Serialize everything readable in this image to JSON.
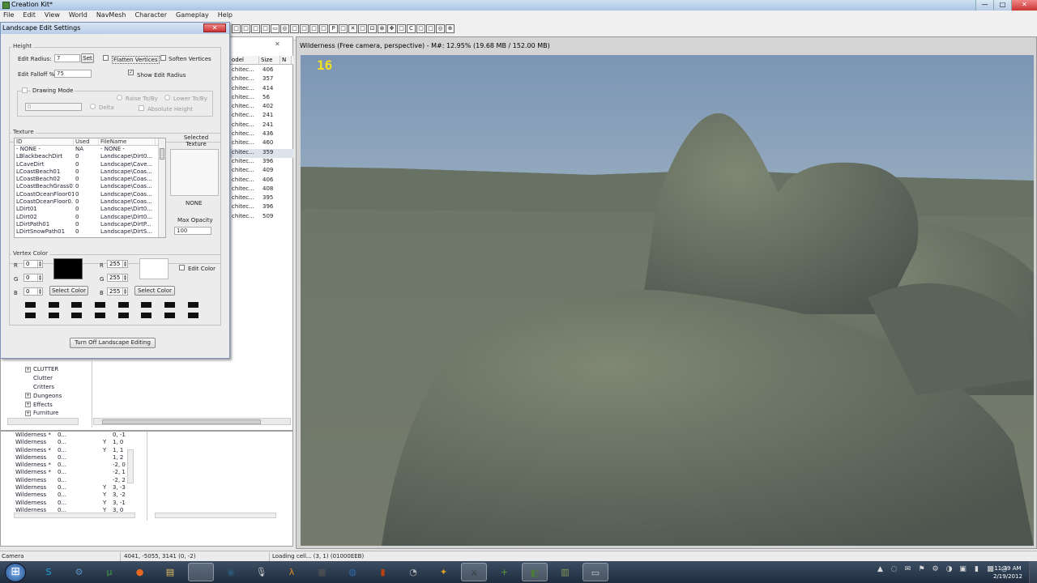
{
  "window": {
    "title": "Creation Kit*",
    "controls": [
      "—",
      "□",
      "✕"
    ]
  },
  "menu": [
    "File",
    "Edit",
    "View",
    "World",
    "NavMesh",
    "Character",
    "Gameplay",
    "Help"
  ],
  "toolbar_icons": [
    "□",
    "□",
    "□",
    "□",
    "▭",
    "◎",
    "□",
    "□",
    "□",
    "□",
    "P",
    "□",
    "✕",
    "□",
    "⊡",
    "⊗",
    "✥",
    "□",
    "C",
    "▢",
    "□",
    "◎",
    "⊕"
  ],
  "object_window": {
    "columns": [
      "odel",
      "Size",
      "N"
    ],
    "rows": [
      {
        "model": "chitec...",
        "size": "406"
      },
      {
        "model": "chitec...",
        "size": "357"
      },
      {
        "model": "chitec...",
        "size": "414"
      },
      {
        "model": "chitec...",
        "size": "56"
      },
      {
        "model": "chitec...",
        "size": "402"
      },
      {
        "model": "chitec...",
        "size": "241"
      },
      {
        "model": "chitec...",
        "size": "241"
      },
      {
        "model": "chitec...",
        "size": "436"
      },
      {
        "model": "chitec...",
        "size": "460"
      },
      {
        "model": "chitec...",
        "size": "359"
      },
      {
        "model": "chitec...",
        "size": "396"
      },
      {
        "model": "chitec...",
        "size": "409"
      },
      {
        "model": "chitec...",
        "size": "406"
      },
      {
        "model": "chitec...",
        "size": "408"
      },
      {
        "model": "chitec...",
        "size": "395"
      },
      {
        "model": "chitec...",
        "size": "396"
      },
      {
        "model": "chitec...",
        "size": "509"
      }
    ],
    "tree": [
      {
        "label": "CLUTTER",
        "expandable": true
      },
      {
        "label": "Clutter",
        "expandable": false
      },
      {
        "label": "Critters",
        "expandable": false
      },
      {
        "label": "Dungeons",
        "expandable": true
      },
      {
        "label": "Effects",
        "expandable": true
      },
      {
        "label": "Furniture",
        "expandable": true
      }
    ]
  },
  "cell_view": {
    "rows": [
      {
        "name": "Wilderness *",
        "editor": "0...",
        "loaded": "",
        "coords": "0, -1"
      },
      {
        "name": "Wilderness",
        "editor": "0...",
        "loaded": "Y",
        "coords": "1, 0"
      },
      {
        "name": "Wilderness *",
        "editor": "0...",
        "loaded": "Y",
        "coords": "1, 1"
      },
      {
        "name": "Wilderness",
        "editor": "0...",
        "loaded": "",
        "coords": "1, 2"
      },
      {
        "name": "Wilderness *",
        "editor": "0...",
        "loaded": "",
        "coords": "-2, 0"
      },
      {
        "name": "Wilderness *",
        "editor": "0...",
        "loaded": "",
        "coords": "-2, 1"
      },
      {
        "name": "Wilderness",
        "editor": "0...",
        "loaded": "",
        "coords": "-2, 2"
      },
      {
        "name": "Wilderness",
        "editor": "0...",
        "loaded": "Y",
        "coords": "3, -3"
      },
      {
        "name": "Wilderness",
        "editor": "0...",
        "loaded": "Y",
        "coords": "3, -2"
      },
      {
        "name": "Wilderness",
        "editor": "0...",
        "loaded": "Y",
        "coords": "3, -1"
      },
      {
        "name": "Wilderness",
        "editor": "0...",
        "loaded": "Y",
        "coords": "3, 0"
      }
    ]
  },
  "render_window": {
    "title": "Wilderness (Free camera, perspective) - M#: 12.95% (19.68 MB / 152.00 MB)",
    "fps": "16"
  },
  "landscape_dialog": {
    "title": "Landscape Edit Settings",
    "close": "✕",
    "height_group": "Height",
    "edit_radius_label": "Edit Radius:",
    "edit_radius": "7",
    "set_button": "Set",
    "flatten_vertices": "Flatten Vertices",
    "soften_vertices": "Soften Vertices",
    "edit_falloff_label": "Edit Falloff %:",
    "edit_falloff": "75",
    "show_edit_radius": "Show Edit Radius",
    "show_edit_radius_checked": "✓",
    "drawing_mode": "Drawing Mode",
    "drawing_value": "0",
    "delta": "Delta",
    "raise_to_by": "Raise To/By",
    "lower_to_by": "Lower To/By",
    "absolute_height": "Absolute Height",
    "texture_group": "Texture",
    "texture_columns": [
      "ID",
      "Used",
      "FileName"
    ],
    "textures": [
      {
        "id": "- NONE -",
        "used": "NA",
        "file": "- NONE -"
      },
      {
        "id": "LBlackbeachDirt",
        "used": "0",
        "file": "Landscape\\Dirt0..."
      },
      {
        "id": "LCaveDirt",
        "used": "0",
        "file": "Landscape\\Cave..."
      },
      {
        "id": "LCoastBeach01",
        "used": "0",
        "file": "Landscape\\Coas..."
      },
      {
        "id": "LCoastBeach02",
        "used": "0",
        "file": "Landscape\\Coas..."
      },
      {
        "id": "LCoastBeachGrass01",
        "used": "0",
        "file": "Landscape\\Coas..."
      },
      {
        "id": "LCoastOceanFloor01",
        "used": "0",
        "file": "Landscape\\Coas..."
      },
      {
        "id": "LCoastOceanFloor0...",
        "used": "0",
        "file": "Landscape\\Coas..."
      },
      {
        "id": "LDirt01",
        "used": "0",
        "file": "Landscape\\Dirt0..."
      },
      {
        "id": "LDirt02",
        "used": "0",
        "file": "Landscape\\Dirt0..."
      },
      {
        "id": "LDirtPath01",
        "used": "0",
        "file": "Landscape\\DirtP..."
      },
      {
        "id": "LDirtSnowPath01",
        "used": "0",
        "file": "Landscape\\DirtS..."
      }
    ],
    "selected_texture_label": "Selected Texture",
    "selected_texture": "NONE",
    "max_opacity_label": "Max Opacity",
    "max_opacity": "100",
    "vertex_color_group": "Vertex Color",
    "left_r": "0",
    "left_g": "0",
    "left_b": "0",
    "right_r": "255",
    "right_g": "255",
    "right_b": "255",
    "r_label": "R",
    "g_label": "G",
    "b_label": "B",
    "select_color": "Select Color",
    "edit_color": "Edit Color",
    "left_color": "#000000",
    "right_color": "#ffffff",
    "turn_off": "Turn Off Landscape Editing"
  },
  "status_bar": {
    "mode": "Camera",
    "coords": "4041, -5055, 3141 (0, -2)",
    "message": "Loading cell... (3, 1) (01000EEB)"
  },
  "taskbar": {
    "start": "⊞",
    "apps": [
      {
        "icon": "skype-icon",
        "glyph": "S",
        "color": "#1ba1e2",
        "active": false
      },
      {
        "icon": "network-icon",
        "glyph": "⚙",
        "color": "#5b8fbf",
        "active": false
      },
      {
        "icon": "utorrent-icon",
        "glyph": "µ",
        "color": "#3fa03f",
        "active": false
      },
      {
        "icon": "firefox-icon",
        "glyph": "●",
        "color": "#e86a1c",
        "active": false
      },
      {
        "icon": "explorer-icon",
        "glyph": "▤",
        "color": "#e8c060",
        "active": false
      },
      {
        "icon": "steam-icon",
        "glyph": "♨",
        "color": "#4a5a6a",
        "active": true
      },
      {
        "icon": "app-icon-7",
        "glyph": "◉",
        "color": "#2a5a7a",
        "active": false
      },
      {
        "icon": "microphone-icon",
        "glyph": "🎙",
        "color": "#cccccc",
        "active": false
      },
      {
        "icon": "half-life-icon",
        "glyph": "λ",
        "color": "#e89020",
        "active": false
      },
      {
        "icon": "media-icon",
        "glyph": "▦",
        "color": "#555555",
        "active": false
      },
      {
        "icon": "globe-icon",
        "glyph": "◍",
        "color": "#2a6aaa",
        "active": false
      },
      {
        "icon": "game-icon",
        "glyph": "▮",
        "color": "#c04010",
        "active": false
      },
      {
        "icon": "clock-icon",
        "glyph": "◔",
        "color": "#b0b0b0",
        "active": false
      },
      {
        "icon": "game-icon-2",
        "glyph": "✦",
        "color": "#e0a020",
        "active": false
      },
      {
        "icon": "skyrim-icon",
        "glyph": "⚔",
        "color": "#333333",
        "active": true
      },
      {
        "icon": "notepad-plus-icon",
        "glyph": "+",
        "color": "#5a9a3a",
        "active": false
      },
      {
        "icon": "creation-kit-icon",
        "glyph": "◧",
        "color": "#4a7a3a",
        "active": true
      },
      {
        "icon": "notes-icon",
        "glyph": "▥",
        "color": "#8a9a5a",
        "active": false
      },
      {
        "icon": "window-icon",
        "glyph": "▭",
        "color": "#cccccc",
        "active": true
      }
    ],
    "tray_icons": [
      "▲",
      "◌",
      "✉",
      "⚑",
      "⚙",
      "◑",
      "▣",
      "▮",
      "▩",
      "◎"
    ],
    "time": "11:39 AM",
    "date": "2/19/2012"
  }
}
